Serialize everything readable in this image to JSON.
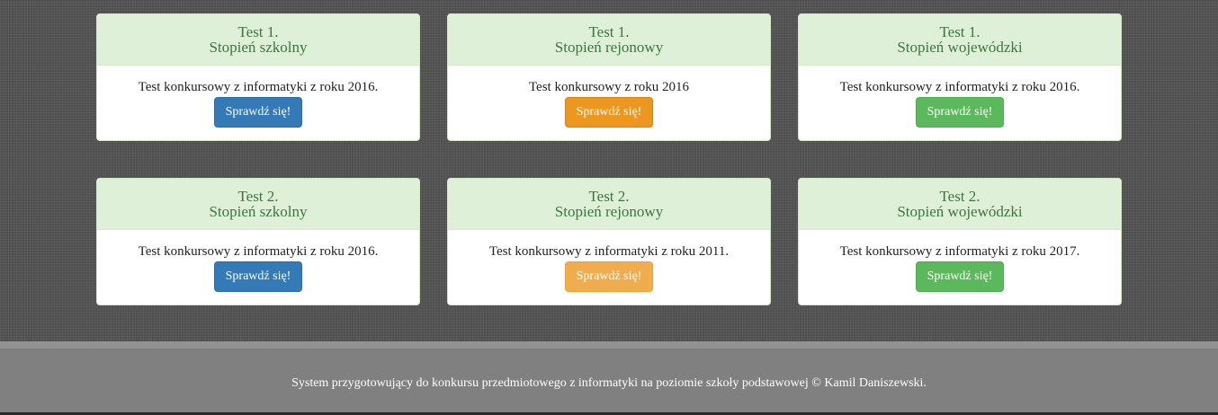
{
  "tests": [
    {
      "title": "Test 1.",
      "level": "Stopień szkolny",
      "description": "Test konkursowy z informatyki z roku 2016.",
      "button_label": "Sprawdź się!",
      "button_color": "#337ab7"
    },
    {
      "title": "Test 1.",
      "level": "Stopień rejonowy",
      "description": "Test konkursowy z roku 2016",
      "button_label": "Sprawdź się!",
      "button_color": "#ec971f"
    },
    {
      "title": "Test 1.",
      "level": "Stopień wojewódzki",
      "description": "Test konkursowy z informatyki z roku 2016.",
      "button_label": "Sprawdź się!",
      "button_color": "#5cb85c"
    },
    {
      "title": "Test 2.",
      "level": "Stopień szkolny",
      "description": "Test konkursowy z informatyki z roku 2016.",
      "button_label": "Sprawdź się!",
      "button_color": "#337ab7"
    },
    {
      "title": "Test 2.",
      "level": "Stopień rejonowy",
      "description": "Test konkursowy z informatyki z roku 2011.",
      "button_label": "Sprawdź się!",
      "button_color": "#f0ad4e"
    },
    {
      "title": "Test 2.",
      "level": "Stopień wojewódzki",
      "description": "Test konkursowy z informatyki z roku 2017.",
      "button_label": "Sprawdź się!",
      "button_color": "#5cb85c"
    }
  ],
  "footer": {
    "text": "System przygotowujący do konkursu przedmiotowego z informatyki na poziomie szkoły podstawowej © Kamil Daniszewski."
  },
  "colors": {
    "panel_heading_bg": "#dff0d8",
    "panel_heading_text": "#3c763d",
    "page_bg": "#555555",
    "footer_bg": "#808080"
  }
}
